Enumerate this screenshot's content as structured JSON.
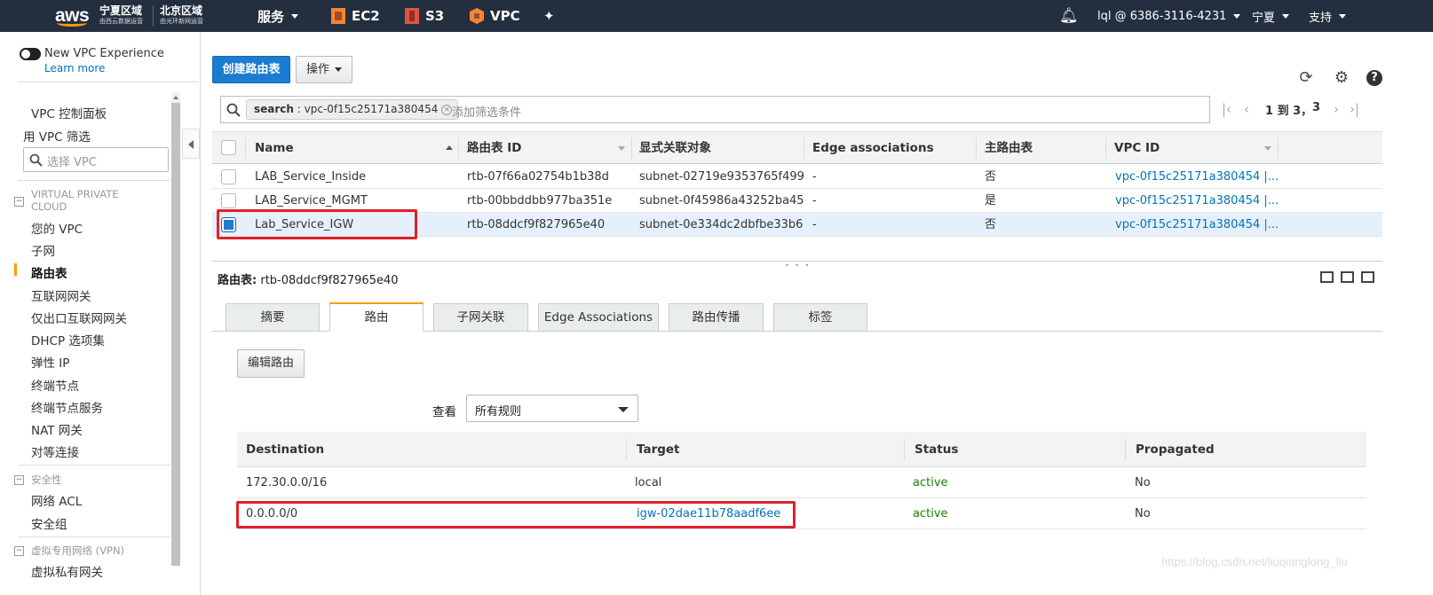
{
  "topbar": {
    "logo": "aws",
    "region1": {
      "title": "宁夏区域",
      "sub": "由西云数据运营"
    },
    "region2": {
      "title": "北京区域",
      "sub": "由光环新网运营"
    },
    "services": "服务",
    "ec2": "EC2",
    "s3": "S3",
    "vpc": "VPC",
    "account": "lql @ 6386-3116-4231",
    "region": "宁夏",
    "support": "支持",
    "colors": {
      "bg": "#232f3e",
      "accent": "#ff9900"
    }
  },
  "sidebar": {
    "new_experience": "New VPC Experience",
    "learn_more": "Learn more",
    "dashboard": "VPC 控制面板",
    "filter_label": "用 VPC 筛选",
    "filter_placeholder": "选择 VPC",
    "sections": [
      {
        "title": "VIRTUAL PRIVATE CLOUD",
        "items": [
          "您的 VPC",
          "子网",
          "路由表",
          "互联网网关",
          "仅出口互联网网关",
          "DHCP 选项集",
          "弹性 IP",
          "终端节点",
          "终端节点服务",
          "NAT 网关",
          "对等连接"
        ]
      },
      {
        "title": "安全性",
        "items": [
          "网络 ACL",
          "安全组"
        ]
      },
      {
        "title": "虚拟专用网络 (VPN)",
        "items": [
          "虚拟私有网关"
        ]
      }
    ],
    "active_item": "路由表"
  },
  "toolbar": {
    "create": "创建路由表",
    "actions": "操作"
  },
  "search": {
    "token_key": "search",
    "token_value": " : vpc-0f15c25171a380454",
    "placeholder": "添加筛选条件"
  },
  "pager": {
    "text": "1 到 3，",
    "total": "3"
  },
  "table": {
    "columns": [
      "Name",
      "路由表 ID",
      "显式关联对象",
      "Edge associations",
      "主路由表",
      "VPC ID"
    ],
    "rows": [
      {
        "name": "LAB_Service_Inside",
        "id": "rtb-07f66a02754b1b38d",
        "assoc": "subnet-02719e9353765f499",
        "edge": "-",
        "main": "否",
        "vpc": "vpc-0f15c25171a380454 |...",
        "selected": false
      },
      {
        "name": "LAB_Service_MGMT",
        "id": "rtb-00bbddbb977ba351e",
        "assoc": "subnet-0f45986a43252ba45",
        "edge": "-",
        "main": "是",
        "vpc": "vpc-0f15c25171a380454 |...",
        "selected": false
      },
      {
        "name": "Lab_Service_IGW",
        "id": "rtb-08ddcf9f827965e40",
        "assoc": "subnet-0e334dc2dbfbe33b6",
        "edge": "-",
        "main": "否",
        "vpc": "vpc-0f15c25171a380454 |...",
        "selected": true
      }
    ]
  },
  "detail": {
    "label": "路由表:",
    "value": "rtb-08ddcf9f827965e40",
    "tabs": [
      "摘要",
      "路由",
      "子网关联",
      "Edge Associations",
      "路由传播",
      "标签"
    ],
    "active_tab": "路由",
    "edit_routes": "编辑路由",
    "view_label": "查看",
    "view_value": "所有规则",
    "routes": {
      "columns": [
        "Destination",
        "Target",
        "Status",
        "Propagated"
      ],
      "rows": [
        {
          "destination": "172.30.0.0/16",
          "target": "local",
          "status": "active",
          "propagated": "No"
        },
        {
          "destination": "0.0.0.0/0",
          "target": "igw-02dae11b78aadf6ee",
          "status": "active",
          "propagated": "No"
        }
      ]
    }
  },
  "watermark": "https://blog.csdn.net/liuqianglong_liu"
}
